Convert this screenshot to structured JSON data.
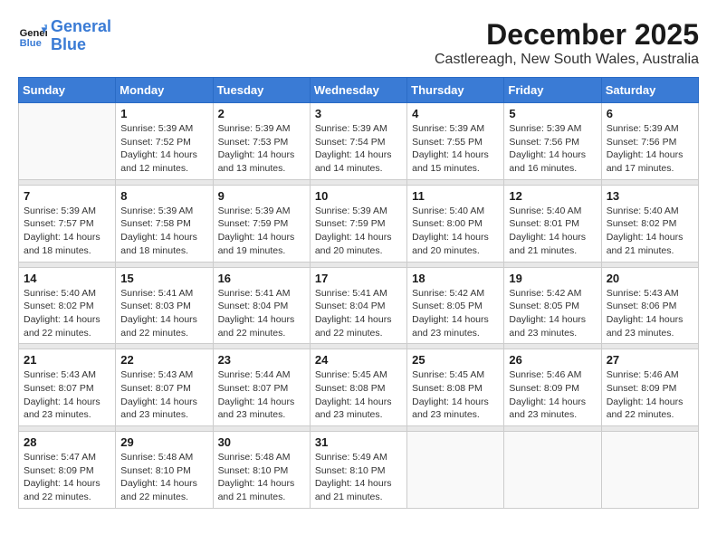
{
  "header": {
    "logo_line1": "General",
    "logo_line2": "Blue",
    "month": "December 2025",
    "location": "Castlereagh, New South Wales, Australia"
  },
  "weekdays": [
    "Sunday",
    "Monday",
    "Tuesday",
    "Wednesday",
    "Thursday",
    "Friday",
    "Saturday"
  ],
  "weeks": [
    [
      {
        "day": "",
        "info": ""
      },
      {
        "day": "1",
        "info": "Sunrise: 5:39 AM\nSunset: 7:52 PM\nDaylight: 14 hours\nand 12 minutes."
      },
      {
        "day": "2",
        "info": "Sunrise: 5:39 AM\nSunset: 7:53 PM\nDaylight: 14 hours\nand 13 minutes."
      },
      {
        "day": "3",
        "info": "Sunrise: 5:39 AM\nSunset: 7:54 PM\nDaylight: 14 hours\nand 14 minutes."
      },
      {
        "day": "4",
        "info": "Sunrise: 5:39 AM\nSunset: 7:55 PM\nDaylight: 14 hours\nand 15 minutes."
      },
      {
        "day": "5",
        "info": "Sunrise: 5:39 AM\nSunset: 7:56 PM\nDaylight: 14 hours\nand 16 minutes."
      },
      {
        "day": "6",
        "info": "Sunrise: 5:39 AM\nSunset: 7:56 PM\nDaylight: 14 hours\nand 17 minutes."
      }
    ],
    [
      {
        "day": "7",
        "info": "Sunrise: 5:39 AM\nSunset: 7:57 PM\nDaylight: 14 hours\nand 18 minutes."
      },
      {
        "day": "8",
        "info": "Sunrise: 5:39 AM\nSunset: 7:58 PM\nDaylight: 14 hours\nand 18 minutes."
      },
      {
        "day": "9",
        "info": "Sunrise: 5:39 AM\nSunset: 7:59 PM\nDaylight: 14 hours\nand 19 minutes."
      },
      {
        "day": "10",
        "info": "Sunrise: 5:39 AM\nSunset: 7:59 PM\nDaylight: 14 hours\nand 20 minutes."
      },
      {
        "day": "11",
        "info": "Sunrise: 5:40 AM\nSunset: 8:00 PM\nDaylight: 14 hours\nand 20 minutes."
      },
      {
        "day": "12",
        "info": "Sunrise: 5:40 AM\nSunset: 8:01 PM\nDaylight: 14 hours\nand 21 minutes."
      },
      {
        "day": "13",
        "info": "Sunrise: 5:40 AM\nSunset: 8:02 PM\nDaylight: 14 hours\nand 21 minutes."
      }
    ],
    [
      {
        "day": "14",
        "info": "Sunrise: 5:40 AM\nSunset: 8:02 PM\nDaylight: 14 hours\nand 22 minutes."
      },
      {
        "day": "15",
        "info": "Sunrise: 5:41 AM\nSunset: 8:03 PM\nDaylight: 14 hours\nand 22 minutes."
      },
      {
        "day": "16",
        "info": "Sunrise: 5:41 AM\nSunset: 8:04 PM\nDaylight: 14 hours\nand 22 minutes."
      },
      {
        "day": "17",
        "info": "Sunrise: 5:41 AM\nSunset: 8:04 PM\nDaylight: 14 hours\nand 22 minutes."
      },
      {
        "day": "18",
        "info": "Sunrise: 5:42 AM\nSunset: 8:05 PM\nDaylight: 14 hours\nand 23 minutes."
      },
      {
        "day": "19",
        "info": "Sunrise: 5:42 AM\nSunset: 8:05 PM\nDaylight: 14 hours\nand 23 minutes."
      },
      {
        "day": "20",
        "info": "Sunrise: 5:43 AM\nSunset: 8:06 PM\nDaylight: 14 hours\nand 23 minutes."
      }
    ],
    [
      {
        "day": "21",
        "info": "Sunrise: 5:43 AM\nSunset: 8:07 PM\nDaylight: 14 hours\nand 23 minutes."
      },
      {
        "day": "22",
        "info": "Sunrise: 5:43 AM\nSunset: 8:07 PM\nDaylight: 14 hours\nand 23 minutes."
      },
      {
        "day": "23",
        "info": "Sunrise: 5:44 AM\nSunset: 8:07 PM\nDaylight: 14 hours\nand 23 minutes."
      },
      {
        "day": "24",
        "info": "Sunrise: 5:45 AM\nSunset: 8:08 PM\nDaylight: 14 hours\nand 23 minutes."
      },
      {
        "day": "25",
        "info": "Sunrise: 5:45 AM\nSunset: 8:08 PM\nDaylight: 14 hours\nand 23 minutes."
      },
      {
        "day": "26",
        "info": "Sunrise: 5:46 AM\nSunset: 8:09 PM\nDaylight: 14 hours\nand 23 minutes."
      },
      {
        "day": "27",
        "info": "Sunrise: 5:46 AM\nSunset: 8:09 PM\nDaylight: 14 hours\nand 22 minutes."
      }
    ],
    [
      {
        "day": "28",
        "info": "Sunrise: 5:47 AM\nSunset: 8:09 PM\nDaylight: 14 hours\nand 22 minutes."
      },
      {
        "day": "29",
        "info": "Sunrise: 5:48 AM\nSunset: 8:10 PM\nDaylight: 14 hours\nand 22 minutes."
      },
      {
        "day": "30",
        "info": "Sunrise: 5:48 AM\nSunset: 8:10 PM\nDaylight: 14 hours\nand 21 minutes."
      },
      {
        "day": "31",
        "info": "Sunrise: 5:49 AM\nSunset: 8:10 PM\nDaylight: 14 hours\nand 21 minutes."
      },
      {
        "day": "",
        "info": ""
      },
      {
        "day": "",
        "info": ""
      },
      {
        "day": "",
        "info": ""
      }
    ]
  ]
}
